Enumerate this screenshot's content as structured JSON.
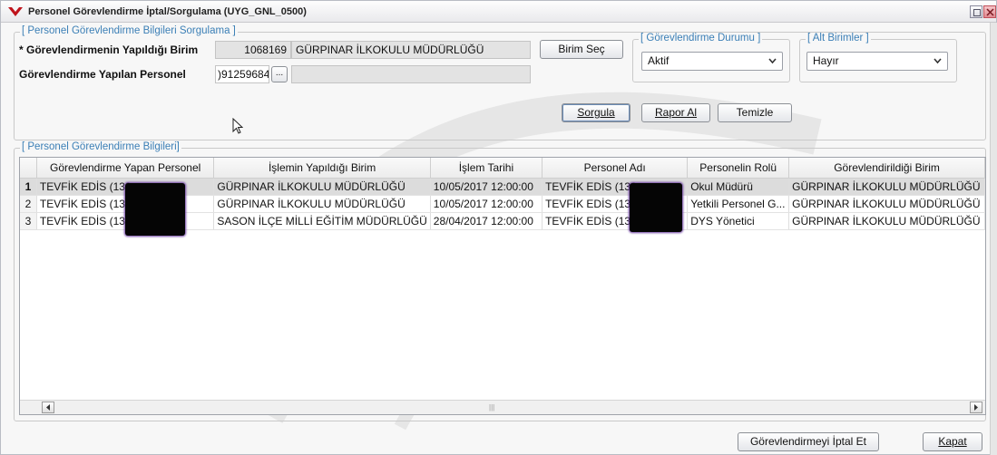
{
  "window": {
    "title": "Personel Görevlendirme İptal/Sorgulama (UYG_GNL_0500)"
  },
  "query_group": {
    "title": "[ Personel Görevlendirme Bilgileri Sorgulama ]",
    "birim_label": "* Görevlendirmenin Yapıldığı Birim",
    "birim_code": "1068169",
    "birim_name": "GÜRPINAR İLKOKULU MÜDÜRLÜĞÜ",
    "personel_label": "Görevlendirme Yapılan Personel",
    "personel_value": ")91259684",
    "personel_browse": "...",
    "personel_name": "",
    "birim_sec_button": "Birim Seç"
  },
  "status_group": {
    "title": "[ Görevlendirme Durumu ]",
    "selected": "Aktif"
  },
  "sub_units_group": {
    "title": "[ Alt Birimler ]",
    "selected": "Hayır"
  },
  "actions": {
    "sorgula": "Sorgula",
    "rapor_al": "Rapor Al",
    "temizle": "Temizle"
  },
  "results_group": {
    "title": "[ Personel Görevlendirme Bilgileri]",
    "columns": [
      "",
      "Görevlendirme Yapan Personel",
      "İşlemin Yapıldığı Birim",
      "İşlem Tarihi",
      "Personel Adı",
      "Personelin Rolü",
      "Görevlendirildiği Birim"
    ],
    "rows": [
      [
        "1",
        "TEVFİK EDİS (130",
        "GÜRPINAR İLKOKULU MÜDÜRLÜĞÜ",
        "10/05/2017 12:00:00",
        "TEVFİK EDİS (130",
        "Okul Müdürü",
        "GÜRPINAR İLKOKULU MÜDÜRLÜĞÜ"
      ],
      [
        "2",
        "TEVFİK EDİS (130",
        "GÜRPINAR İLKOKULU MÜDÜRLÜĞÜ",
        "10/05/2017 12:00:00",
        "TEVFİK EDİS (130",
        "Yetkili Personel G...",
        "GÜRPINAR İLKOKULU MÜDÜRLÜĞÜ"
      ],
      [
        "3",
        "TEVFİK EDİS (130",
        "SASON İLÇE MİLLİ EĞİTİM MÜDÜRLÜĞÜ",
        "28/04/2017 12:00:00",
        "TEVFİK EDİS (130",
        "DYS Yönetici",
        "GÜRPINAR İLKOKULU MÜDÜRLÜĞÜ"
      ]
    ],
    "selected_row": 1,
    "scroll_grip": "|||"
  },
  "footer": {
    "iptal_button": "Görevlendirmeyi İptal Et",
    "kapat_button": "Kapat"
  },
  "colors": {
    "group_title": "#3b7fb6",
    "selected_row": "#dcdcdc",
    "redaction": "#050505"
  }
}
